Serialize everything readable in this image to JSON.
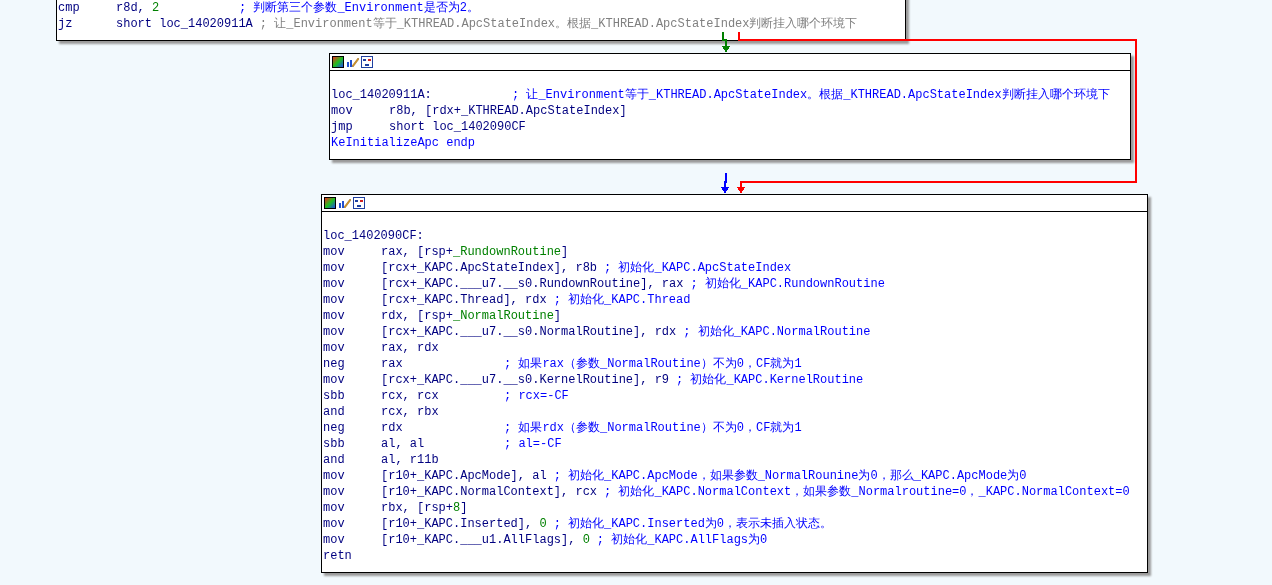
{
  "nodes": [
    {
      "header_icons": false,
      "lines": [
        {
          "kind": "instr",
          "mnemonic": "cmp",
          "operands": [
            {
              "text": "r8d, ",
              "kind": "plain"
            },
            {
              "text": "2",
              "kind": "num"
            }
          ],
          "comment": "; 判断第三个参数_Environment是否为2。",
          "repeatable": false
        },
        {
          "kind": "instr",
          "mnemonic": "jz",
          "operands": [
            {
              "text": "short loc_14020911A",
              "kind": "plain"
            }
          ],
          "comment": "; 让_Environment等于_KTHREAD.ApcStateIndex。根据_KTHREAD.ApcStateIndex判断挂入哪个环境下",
          "repeatable": true
        }
      ]
    },
    {
      "header_icons": true,
      "lines": [
        {
          "kind": "blank"
        },
        {
          "kind": "label",
          "text": "loc_14020911A:",
          "comment": "; 让_Environment等于_KTHREAD.ApcStateIndex。根据_KTHREAD.ApcStateIndex判断挂入哪个环境下",
          "repeatable": false
        },
        {
          "kind": "instr",
          "mnemonic": "mov",
          "operands": [
            {
              "text": "r8b, [rdx+_KTHREAD.ApcStateIndex]",
              "kind": "plain"
            }
          ]
        },
        {
          "kind": "instr",
          "mnemonic": "jmp",
          "operands": [
            {
              "text": "short loc_1402090CF",
              "kind": "plain"
            }
          ]
        },
        {
          "kind": "directive",
          "text": "KeInitializeApc endp"
        }
      ]
    },
    {
      "header_icons": true,
      "lines": [
        {
          "kind": "blank"
        },
        {
          "kind": "label",
          "text": "loc_1402090CF:"
        },
        {
          "kind": "instr",
          "mnemonic": "mov",
          "operands": [
            {
              "text": "rax, [rsp+",
              "kind": "plain"
            },
            {
              "text": "_RundownRoutine",
              "kind": "var"
            },
            {
              "text": "]",
              "kind": "plain"
            }
          ]
        },
        {
          "kind": "instr",
          "mnemonic": "mov",
          "operands": [
            {
              "text": "[rcx+_KAPC.ApcStateIndex], r8b",
              "kind": "plain"
            }
          ],
          "comment": "; 初始化_KAPC.ApcStateIndex",
          "repeatable": false
        },
        {
          "kind": "instr",
          "mnemonic": "mov",
          "operands": [
            {
              "text": "[rcx+_KAPC.___u7.__s0.RundownRoutine], rax",
              "kind": "plain"
            }
          ],
          "comment": "; 初始化_KAPC.RundownRoutine",
          "repeatable": false
        },
        {
          "kind": "instr",
          "mnemonic": "mov",
          "operands": [
            {
              "text": "[rcx+_KAPC.Thread], rdx",
              "kind": "plain"
            }
          ],
          "comment": "; 初始化_KAPC.Thread",
          "repeatable": false
        },
        {
          "kind": "instr",
          "mnemonic": "mov",
          "operands": [
            {
              "text": "rdx, [rsp+",
              "kind": "plain"
            },
            {
              "text": "_NormalRoutine",
              "kind": "var"
            },
            {
              "text": "]",
              "kind": "plain"
            }
          ]
        },
        {
          "kind": "instr",
          "mnemonic": "mov",
          "operands": [
            {
              "text": "[rcx+_KAPC.___u7.__s0.NormalRoutine], rdx",
              "kind": "plain"
            }
          ],
          "comment": "; 初始化_KAPC.NormalRoutine",
          "repeatable": false
        },
        {
          "kind": "instr",
          "mnemonic": "mov",
          "operands": [
            {
              "text": "rax, rdx",
              "kind": "plain"
            }
          ]
        },
        {
          "kind": "instr",
          "mnemonic": "neg",
          "operands": [
            {
              "text": "rax",
              "kind": "plain"
            }
          ],
          "comment": "; 如果rax（参数_NormalRoutine）不为0，CF就为1",
          "repeatable": false
        },
        {
          "kind": "instr",
          "mnemonic": "mov",
          "operands": [
            {
              "text": "[rcx+_KAPC.___u7.__s0.KernelRoutine], r9",
              "kind": "plain"
            }
          ],
          "comment": "; 初始化_KAPC.KernelRoutine",
          "repeatable": false
        },
        {
          "kind": "instr",
          "mnemonic": "sbb",
          "operands": [
            {
              "text": "rcx, rcx",
              "kind": "plain"
            }
          ],
          "comment": "; rcx=-CF",
          "repeatable": false
        },
        {
          "kind": "instr",
          "mnemonic": "and",
          "operands": [
            {
              "text": "rcx, rbx",
              "kind": "plain"
            }
          ]
        },
        {
          "kind": "instr",
          "mnemonic": "neg",
          "operands": [
            {
              "text": "rdx",
              "kind": "plain"
            }
          ],
          "comment": "; 如果rdx（参数_NormalRoutine）不为0，CF就为1",
          "repeatable": false
        },
        {
          "kind": "instr",
          "mnemonic": "sbb",
          "operands": [
            {
              "text": "al, al",
              "kind": "plain"
            }
          ],
          "comment": "; al=-CF",
          "repeatable": false
        },
        {
          "kind": "instr",
          "mnemonic": "and",
          "operands": [
            {
              "text": "al, r11b",
              "kind": "plain"
            }
          ]
        },
        {
          "kind": "instr",
          "mnemonic": "mov",
          "operands": [
            {
              "text": "[r10+_KAPC.ApcMode], al",
              "kind": "plain"
            }
          ],
          "comment": "; 初始化_KAPC.ApcMode，如果参数_NormalRounine为0，那么_KAPC.ApcMode为0",
          "repeatable": false
        },
        {
          "kind": "instr",
          "mnemonic": "mov",
          "operands": [
            {
              "text": "[r10+_KAPC.NormalContext], rcx",
              "kind": "plain"
            }
          ],
          "comment": "; 初始化_KAPC.NormalContext，如果参数_Normalroutine=0，_KAPC.NormalContext=0",
          "repeatable": false
        },
        {
          "kind": "instr",
          "mnemonic": "mov",
          "operands": [
            {
              "text": "rbx, [rsp+",
              "kind": "plain"
            },
            {
              "text": "8",
              "kind": "num"
            },
            {
              "text": "]",
              "kind": "plain"
            }
          ]
        },
        {
          "kind": "instr",
          "mnemonic": "mov",
          "operands": [
            {
              "text": "[r10+_KAPC.Inserted], ",
              "kind": "plain"
            },
            {
              "text": "0",
              "kind": "num"
            }
          ],
          "comment": "; 初始化_KAPC.Inserted为0，表示未插入状态。",
          "repeatable": false
        },
        {
          "kind": "instr",
          "mnemonic": "mov",
          "operands": [
            {
              "text": "[r10+_KAPC.___u1.AllFlags], ",
              "kind": "plain"
            },
            {
              "text": "0",
              "kind": "num"
            }
          ],
          "comment": "; 初始化_KAPC.AllFlags为0",
          "repeatable": false
        },
        {
          "kind": "instr",
          "mnemonic": "retn"
        }
      ]
    }
  ],
  "edges": [
    {
      "color": "#008000"
    },
    {
      "color": "#ff0000"
    },
    {
      "color": "#0000ff"
    }
  ]
}
